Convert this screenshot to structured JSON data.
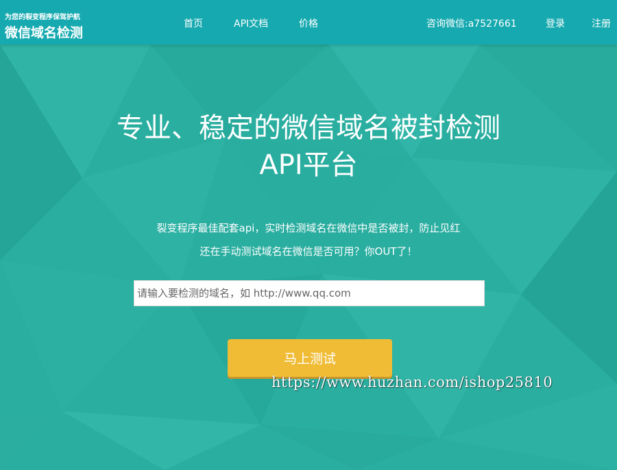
{
  "header": {
    "logo_tagline": "为您的裂变程序保驾护航",
    "logo_title": "微信域名检测",
    "nav": [
      {
        "label": "首页"
      },
      {
        "label": "API文档"
      },
      {
        "label": "价格"
      }
    ],
    "contact": "咨询微信:a7527661",
    "login_label": "登录",
    "register_label": "注册"
  },
  "hero": {
    "title_line1": "专业、稳定的微信域名被封检测",
    "title_line2": "API平台",
    "subtitle_line1": "裂变程序最佳配套api，实时检测域名在微信中是否被封，防止见红",
    "subtitle_line2": "还在手动测试域名在微信是否可用？你OUT了！"
  },
  "search": {
    "placeholder": "请输入要检测的域名，如 http://www.qq.com",
    "value": ""
  },
  "test_button_label": "马上测试",
  "watermark": "https://www.huzhan.com/ishop25810",
  "colors": {
    "background": "#2aaea0",
    "header": "#16aab0",
    "button": "#f0bc36"
  }
}
